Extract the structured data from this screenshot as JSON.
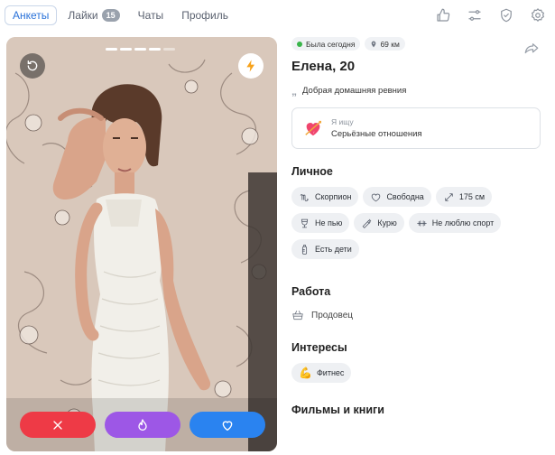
{
  "nav": {
    "tabs": [
      {
        "label": "Анкеты"
      },
      {
        "label": "Лайки",
        "badge": "15"
      },
      {
        "label": "Чаты"
      },
      {
        "label": "Профиль"
      }
    ],
    "icons": [
      "thumbs-up-icon",
      "sliders-icon",
      "shield-check-icon",
      "settings-icon"
    ]
  },
  "photo": {
    "total_photos": 5,
    "current_photo": 4,
    "actions": [
      "dislike",
      "superlike",
      "like"
    ]
  },
  "profile": {
    "status": "Была сегодня",
    "distance": "69 км",
    "name": "Елена, 20",
    "about": "Добрая домашняя ревния",
    "looking": {
      "label": "Я ищу",
      "value": "Серьёзные отношения"
    },
    "personal_title": "Личное",
    "personal": [
      {
        "icon": "zodiac-icon",
        "text": "Скорпион"
      },
      {
        "icon": "heart-outline-icon",
        "text": "Свободна"
      },
      {
        "icon": "height-icon",
        "text": "175 см"
      },
      {
        "icon": "glass-icon",
        "text": "Не пью"
      },
      {
        "icon": "cigarette-icon",
        "text": "Курю"
      },
      {
        "icon": "dumbbell-icon",
        "text": "Не люблю спорт"
      },
      {
        "icon": "baby-bottle-icon",
        "text": "Есть дети"
      }
    ],
    "work_title": "Работа",
    "work": "Продовец",
    "interests_title": "Интересы",
    "interests": [
      {
        "emoji": "💪",
        "text": "Фитнес"
      }
    ],
    "films_title": "Фильмы и книги"
  },
  "colors": {
    "accent": "#2a72d9",
    "dislike": "#ee3a46",
    "superlike": "#9d57e6",
    "like": "#2a83f0",
    "online": "#39b54a"
  }
}
